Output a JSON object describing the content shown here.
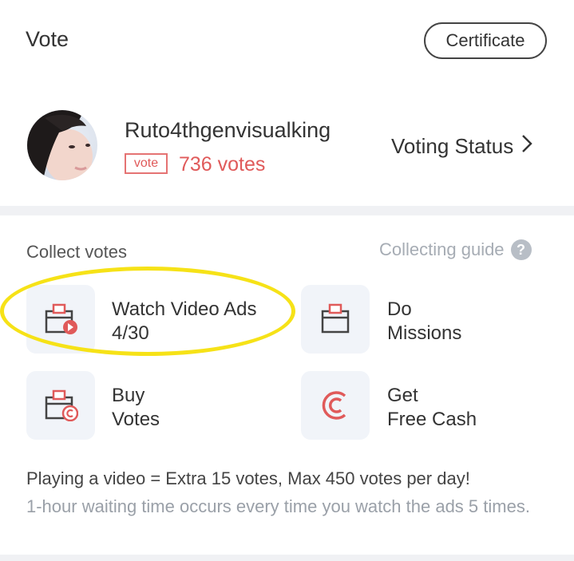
{
  "header": {
    "title": "Vote",
    "certificate_label": "Certificate"
  },
  "profile": {
    "username": "Ruto4thgenvisualking",
    "badge": "vote",
    "votes": "736 votes",
    "voting_status_label": "Voting Status"
  },
  "collect": {
    "label": "Collect votes",
    "guide_label": "Collecting guide",
    "options": [
      {
        "line1": "Watch Video Ads",
        "line2": "4/30"
      },
      {
        "line1": "Do",
        "line2": "Missions"
      },
      {
        "line1": "Buy",
        "line2": "Votes"
      },
      {
        "line1": "Get",
        "line2": "Free Cash"
      }
    ]
  },
  "notes": {
    "primary": "Playing a video = Extra 15 votes, Max 450 votes per day!",
    "secondary": "1-hour waiting time occurs every time you watch the ads 5 times."
  },
  "colors": {
    "accent_red": "#e05a5a",
    "highlight_yellow": "#f6e217",
    "icon_bg": "#f1f4f9"
  }
}
